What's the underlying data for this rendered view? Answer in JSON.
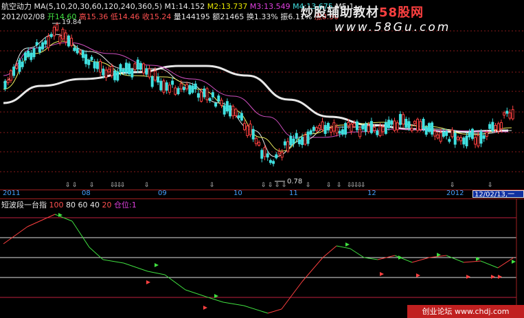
{
  "header": {
    "stock_name": "航空动力",
    "ma_params": "MA(5,10,20,30,60,120,240,360,5)",
    "m1": "M1:14.152",
    "m2": "M2:13.737",
    "m3": "M3:13.549",
    "m4": "M4:13.675",
    "m5": "M5:1",
    "date": "2012/02/08",
    "open": "开14.60",
    "high": "高15.36",
    "low": "低14.46",
    "close": "收15.24",
    "volume": "量144195",
    "amount": "额21465",
    "turnover": "换1.33%",
    "amplitude": "振6.11%",
    "change": "涨0.50"
  },
  "watermark": {
    "line1_prefix": "炒股辅助教材",
    "line1_brand": "58股网",
    "line2": "www.58Gu.com"
  },
  "annotations": {
    "high_price": "19.84",
    "low_price": "0.78"
  },
  "time_axis": {
    "months": [
      "2011",
      "08",
      "09",
      "10",
      "11",
      "12",
      "2012"
    ],
    "selected_date": "12/02/13,一"
  },
  "indicator": {
    "name": "短波段一台指",
    "levels": [
      "100",
      "80",
      "60",
      "40",
      "20"
    ],
    "position": "仓位:1"
  },
  "footer_watermark": "创业论坛 www.chdj.com",
  "colors": {
    "background": "#000000",
    "up_candle": "#ff4040",
    "down_candle": "#40e0e0",
    "ma_long": "#e0e0e0",
    "indicator_up": "#ff4040",
    "indicator_down": "#40e040"
  }
}
